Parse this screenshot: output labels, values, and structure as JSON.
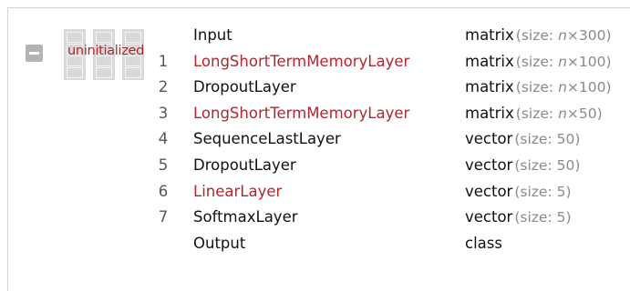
{
  "net": {
    "state_label": "uninitialized",
    "icon": "layer-stack-icon",
    "collapse_icon": "minus-icon"
  },
  "colors": {
    "uninitialized": "#b1272d",
    "default_text": "#111111",
    "size_text": "#8a8a8a",
    "icon_gray": "#b3b3b3"
  },
  "layers": [
    {
      "num": "",
      "name": "Input",
      "uninitialized": false,
      "type": "matrix",
      "size_prefix": "(size: ",
      "size_var": "n",
      "size_rest": "×300)"
    },
    {
      "num": "1",
      "name": "LongShortTermMemoryLayer",
      "uninitialized": true,
      "type": "matrix",
      "size_prefix": "(size: ",
      "size_var": "n",
      "size_rest": "×100)"
    },
    {
      "num": "2",
      "name": "DropoutLayer",
      "uninitialized": false,
      "type": "matrix",
      "size_prefix": "(size: ",
      "size_var": "n",
      "size_rest": "×100)"
    },
    {
      "num": "3",
      "name": "LongShortTermMemoryLayer",
      "uninitialized": true,
      "type": "matrix",
      "size_prefix": "(size: ",
      "size_var": "n",
      "size_rest": "×50)"
    },
    {
      "num": "4",
      "name": "SequenceLastLayer",
      "uninitialized": false,
      "type": "vector",
      "size_prefix": "(size: 50)",
      "size_var": "",
      "size_rest": ""
    },
    {
      "num": "5",
      "name": "DropoutLayer",
      "uninitialized": false,
      "type": "vector",
      "size_prefix": "(size: 50)",
      "size_var": "",
      "size_rest": ""
    },
    {
      "num": "6",
      "name": "LinearLayer",
      "uninitialized": true,
      "type": "vector",
      "size_prefix": "(size: 5)",
      "size_var": "",
      "size_rest": ""
    },
    {
      "num": "7",
      "name": "SoftmaxLayer",
      "uninitialized": false,
      "type": "vector",
      "size_prefix": "(size: 5)",
      "size_var": "",
      "size_rest": ""
    },
    {
      "num": "",
      "name": "Output",
      "uninitialized": false,
      "type": "class",
      "size_prefix": "",
      "size_var": "",
      "size_rest": ""
    }
  ]
}
